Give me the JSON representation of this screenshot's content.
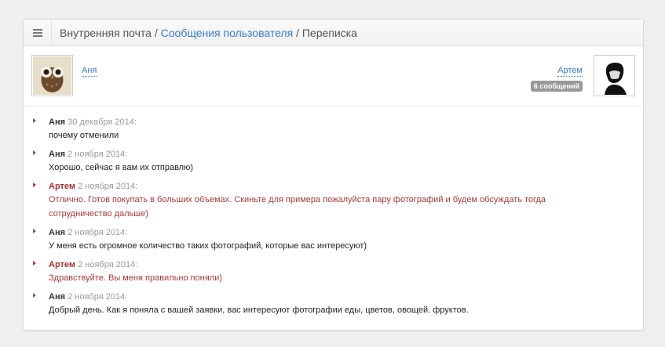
{
  "breadcrumb": {
    "item1": "Внутренняя почта",
    "sep": " / ",
    "item2": "Сообщения пользователя",
    "item3": "Переписка"
  },
  "users": {
    "left": {
      "name": "Аня"
    },
    "right": {
      "name": "Артем",
      "badge": "6 сообщений"
    }
  },
  "messages": [
    {
      "author": "Аня",
      "date": "30 декабря 2014:",
      "text": "почему отменили",
      "side": "left"
    },
    {
      "author": "Аня",
      "date": "2 ноября 2014:",
      "text": "Хорошо, сейчас я вам их отправлю)",
      "side": "left"
    },
    {
      "author": "Артем",
      "date": "2 ноября 2014:",
      "text": "Отлично. Готов покупать в больших объемах. Скиньте для примера пожалуйста пару фотографий и будем обсуждать тогда сотрудничество дальше)",
      "side": "right"
    },
    {
      "author": "Аня",
      "date": "2 ноября 2014:",
      "text": "У меня есть огромное количество таких фотографий, которые вас интересуют)",
      "side": "left"
    },
    {
      "author": "Артем",
      "date": "2 ноября 2014:",
      "text": "Здравствуйте. Вы меня правильно поняли)",
      "side": "right"
    },
    {
      "author": "Аня",
      "date": "2 ноября 2014:",
      "text": "Добрый день. Как я поняла с вашей заявки, вас интересуют фотографии еды, цветов, овощей. фруктов.",
      "side": "left"
    }
  ],
  "colors": {
    "link": "#3a7cc6",
    "right_author": "#9b3232",
    "right_text": "#a33a3a",
    "badge": "#999999"
  }
}
